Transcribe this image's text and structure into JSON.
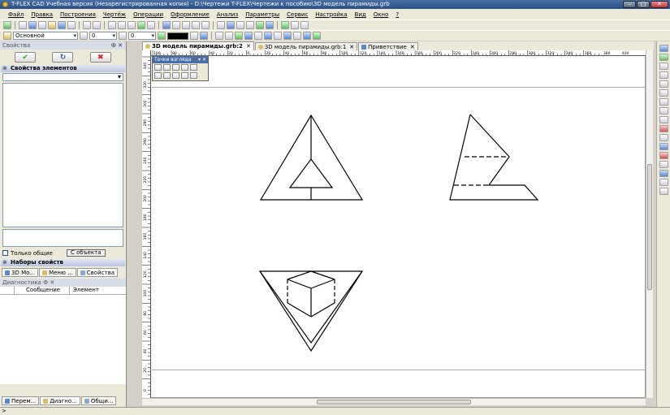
{
  "window": {
    "title": "T-FLEX CAD Учебная версия (Незарегистрированная копия) - D:\\Чертежи T-FLEX\\Чертежи к пособию\\3D модель пирамиды.grb"
  },
  "menu": [
    "Файл",
    "Правка",
    "Построения",
    "Чертёж",
    "Операции",
    "Оформление",
    "Анализ",
    "Параметры",
    "Сервис",
    "Настройка",
    "Вид",
    "Окно",
    "?"
  ],
  "toolbar2": {
    "layer": "Основной",
    "line_width": "0",
    "line_type": "0"
  },
  "left_panel": {
    "title": "Свойства",
    "pin": "Ф ✕",
    "ok_symbol": "✔",
    "refresh_symbol": "↻",
    "cancel_symbol": "✖",
    "section_elements": "Свойства элементов",
    "only_common_label": "Только общие",
    "from_object_button": "С объекта",
    "section_sets": "Наборы свойств",
    "tabs": [
      "3D Мо...",
      "Меню ...",
      "Свойства"
    ]
  },
  "diagnostics": {
    "title": "Диагностика",
    "pin": "Ф ✕",
    "col_message": "Сообщение",
    "col_element": "Элемент"
  },
  "bottom_tabs": [
    "Перем...",
    "Диагно...",
    "Общи..."
  ],
  "doc_tabs": [
    {
      "label": "3D модель пирамиды.grb:2",
      "active": true
    },
    {
      "label": "3D модель пирамиды.grb:1",
      "active": false
    },
    {
      "label": "Приветствие",
      "active": false
    }
  ],
  "view_points_toolbar": {
    "title": "Точки взгляда"
  },
  "ruler_top_labels": [
    "100",
    "80",
    "60",
    "40",
    "20",
    "0",
    "20",
    "40",
    "60",
    "80",
    "100",
    "120",
    "140",
    "160",
    "180",
    "200",
    "220",
    "240",
    "260",
    "280",
    "300",
    "320",
    "340",
    "360",
    "380",
    "400"
  ],
  "ruler_left_labels": [
    "0",
    "20",
    "40",
    "60",
    "80",
    "100",
    "120",
    "140",
    "160",
    "180",
    "200",
    "220",
    "240",
    "260",
    "280",
    "300",
    "320",
    "340"
  ],
  "status_bar": {
    "text": ">"
  },
  "colors": {
    "title_bar": "#2a4e86",
    "panel_bg": "#ece9d8",
    "canvas": "#ffffff"
  }
}
